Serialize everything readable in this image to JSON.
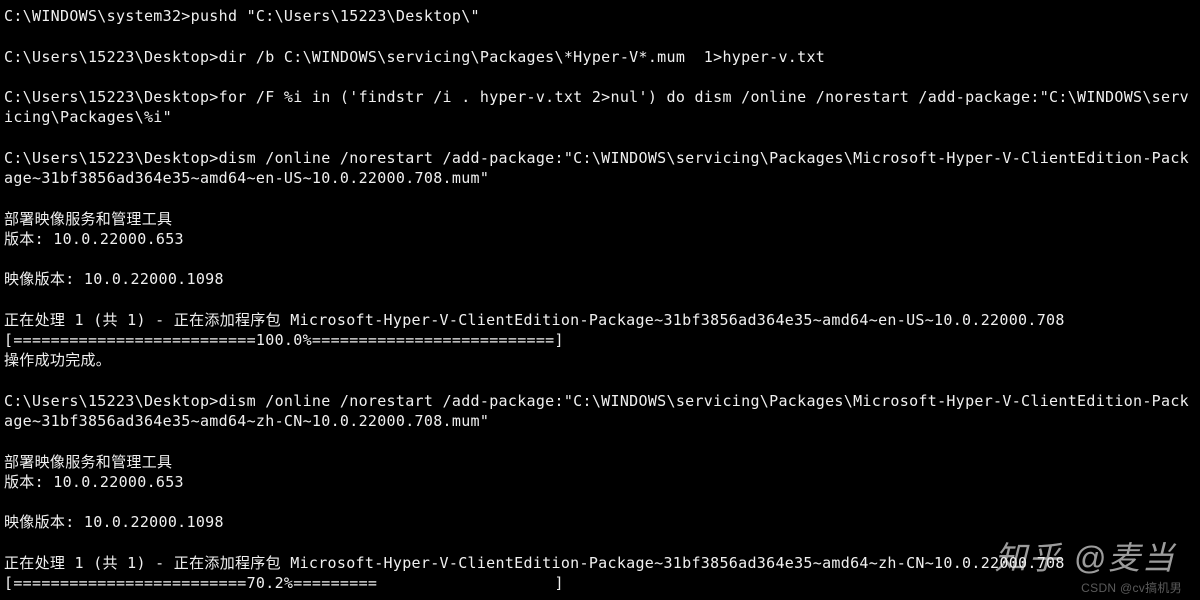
{
  "terminal": {
    "lines": [
      {
        "type": "text",
        "text": "C:\\WINDOWS\\system32>pushd \"C:\\Users\\15223\\Desktop\\\""
      },
      {
        "type": "blank"
      },
      {
        "type": "text",
        "text": "C:\\Users\\15223\\Desktop>dir /b C:\\WINDOWS\\servicing\\Packages\\*Hyper-V*.mum  1>hyper-v.txt"
      },
      {
        "type": "blank"
      },
      {
        "type": "text",
        "text": "C:\\Users\\15223\\Desktop>for /F %i in ('findstr /i . hyper-v.txt 2>nul') do dism /online /norestart /add-package:\"C:\\WINDOWS\\servicing\\Packages\\%i\""
      },
      {
        "type": "blank"
      },
      {
        "type": "text",
        "text": "C:\\Users\\15223\\Desktop>dism /online /norestart /add-package:\"C:\\WINDOWS\\servicing\\Packages\\Microsoft-Hyper-V-ClientEdition-Package~31bf3856ad364e35~amd64~en-US~10.0.22000.708.mum\""
      },
      {
        "type": "blank"
      },
      {
        "type": "text",
        "text": "部署映像服务和管理工具"
      },
      {
        "type": "text",
        "text": "版本: 10.0.22000.653"
      },
      {
        "type": "blank"
      },
      {
        "type": "text",
        "text": "映像版本: 10.0.22000.1098"
      },
      {
        "type": "blank"
      },
      {
        "type": "text",
        "text": "正在处理 1 (共 1) - 正在添加程序包 Microsoft-Hyper-V-ClientEdition-Package~31bf3856ad364e35~amd64~en-US~10.0.22000.708"
      },
      {
        "type": "text",
        "text": "[==========================100.0%==========================]"
      },
      {
        "type": "text",
        "text": "操作成功完成。"
      },
      {
        "type": "blank"
      },
      {
        "type": "text",
        "text": "C:\\Users\\15223\\Desktop>dism /online /norestart /add-package:\"C:\\WINDOWS\\servicing\\Packages\\Microsoft-Hyper-V-ClientEdition-Package~31bf3856ad364e35~amd64~zh-CN~10.0.22000.708.mum\""
      },
      {
        "type": "blank"
      },
      {
        "type": "text",
        "text": "部署映像服务和管理工具"
      },
      {
        "type": "text",
        "text": "版本: 10.0.22000.653"
      },
      {
        "type": "blank"
      },
      {
        "type": "text",
        "text": "映像版本: 10.0.22000.1098"
      },
      {
        "type": "blank"
      },
      {
        "type": "text",
        "text": "正在处理 1 (共 1) - 正在添加程序包 Microsoft-Hyper-V-ClientEdition-Package~31bf3856ad364e35~amd64~zh-CN~10.0.22000.708"
      },
      {
        "type": "text",
        "text": "[=========================70.2%=========                   ]"
      }
    ]
  },
  "watermarks": {
    "zhihu": "知乎 @麦当",
    "csdn": "CSDN @cv搞机男"
  }
}
